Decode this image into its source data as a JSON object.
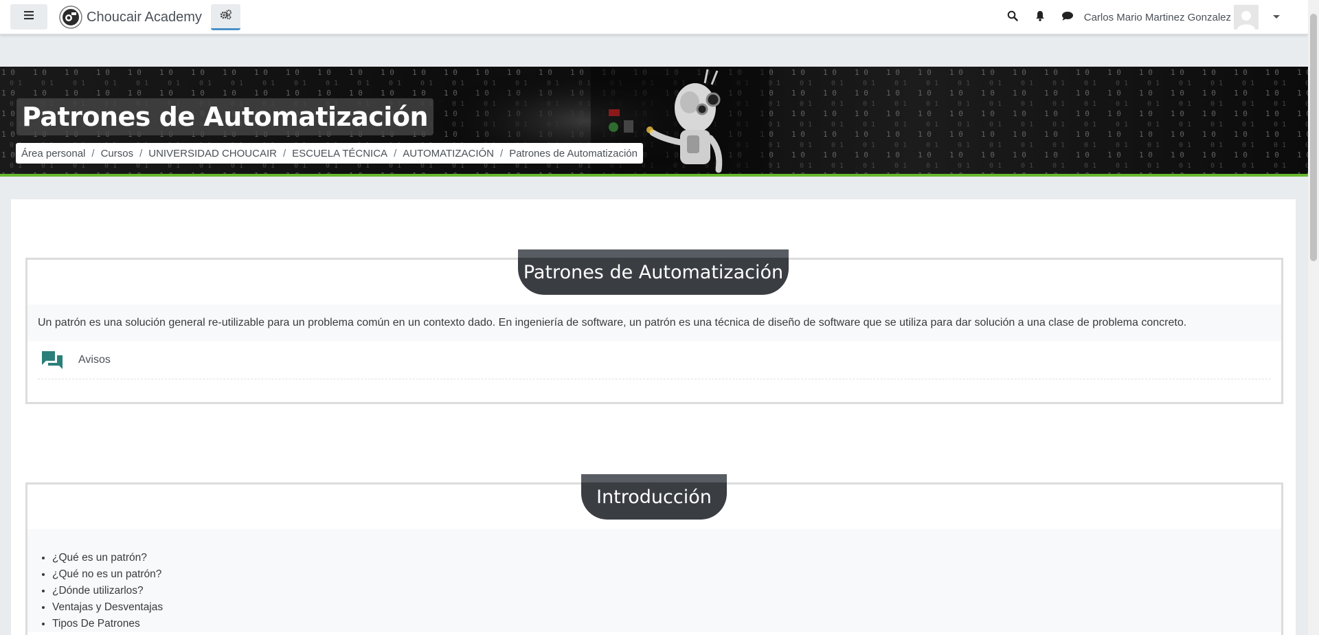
{
  "navbar": {
    "brand_name": "Choucair Academy",
    "user_name": "Carlos Mario Martinez Gonzalez",
    "menu_icon": "hamburger-icon",
    "settings_icon": "gears-icon",
    "search_icon": "search-icon",
    "notifications_icon": "bell-icon",
    "messages_icon": "chat-icon",
    "accent_color": "#4a90c8"
  },
  "header": {
    "title": "Patrones de Automatización",
    "accent_bar_color": "#68b92e",
    "breadcrumb": [
      "Área personal",
      "Cursos",
      "UNIVERSIDAD CHOUCAIR",
      "ESCUELA TÉCNICA",
      "AUTOMATIZACIÓN",
      "Patrones de Automatización"
    ]
  },
  "sections": [
    {
      "title": "Patrones de Automatización",
      "summary": "Un patrón es una solución general re-utilizable para un problema común en un contexto dado. En ingeniería de software, un patrón es una técnica de diseño de software que se utiliza para dar solución a una clase de problema concreto.",
      "activities": [
        {
          "name": "Avisos",
          "icon": "forum-icon",
          "icon_color": "#399be2"
        }
      ]
    },
    {
      "title": "Introducción",
      "items": [
        "¿Qué es un patrón?",
        "¿Qué no es un patrón?",
        "¿Dónde utilizarlos?",
        "Ventajas y Desventajas",
        "Tipos De Patrones"
      ]
    }
  ]
}
